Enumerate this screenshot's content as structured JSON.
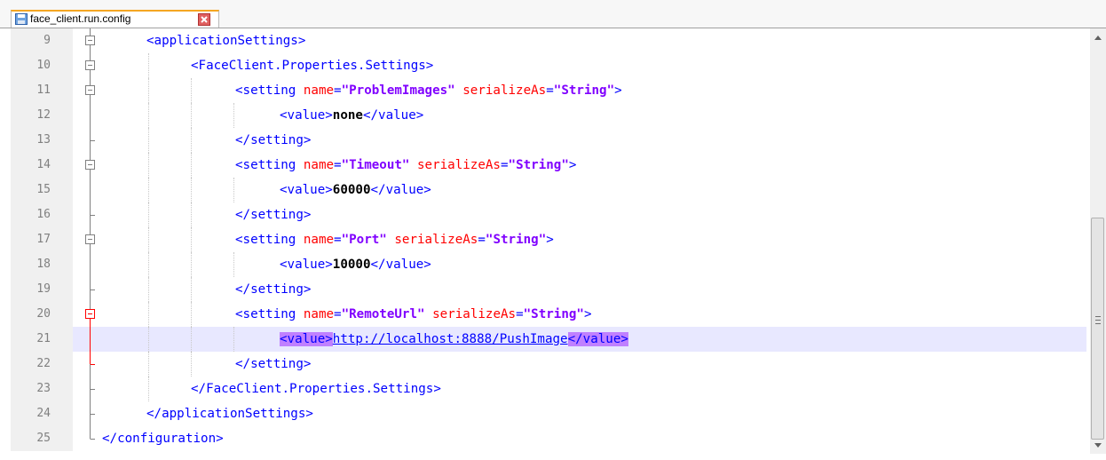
{
  "tab": {
    "title": "face_client.run.config",
    "file_icon": "save-icon",
    "close_icon": "close-icon"
  },
  "colors": {
    "tag": "#0000ff",
    "attribute": "#ff0000",
    "attribute_value": "#8000ff",
    "text": "#000000",
    "current_line": "#e8e8ff",
    "tag_match": "#c080ff",
    "fold_active": "#ff0000"
  },
  "editor": {
    "current_line": 21,
    "lines": [
      {
        "num": "9",
        "fold": "box-open",
        "indent": 1,
        "parts": [
          {
            "t": "tag",
            "v": "<applicationSettings>"
          }
        ]
      },
      {
        "num": "10",
        "fold": "box-open",
        "indent": 2,
        "parts": [
          {
            "t": "tag",
            "v": "<FaceClient.Properties.Settings>"
          }
        ]
      },
      {
        "num": "11",
        "fold": "box-open",
        "indent": 3,
        "parts": [
          {
            "t": "tag",
            "v": "<setting "
          },
          {
            "t": "attr",
            "v": "name"
          },
          {
            "t": "tag",
            "v": "="
          },
          {
            "t": "val",
            "v": "\"ProblemImages\""
          },
          {
            "t": "tag",
            "v": " "
          },
          {
            "t": "attr",
            "v": "serializeAs"
          },
          {
            "t": "tag",
            "v": "="
          },
          {
            "t": "val",
            "v": "\"String\""
          },
          {
            "t": "tag",
            "v": ">"
          }
        ]
      },
      {
        "num": "12",
        "fold": "line",
        "indent": 4,
        "parts": [
          {
            "t": "tag",
            "v": "<value>"
          },
          {
            "t": "txt",
            "v": "none"
          },
          {
            "t": "tag",
            "v": "</value>"
          }
        ]
      },
      {
        "num": "13",
        "fold": "end",
        "indent": 3,
        "parts": [
          {
            "t": "tag",
            "v": "</setting>"
          }
        ]
      },
      {
        "num": "14",
        "fold": "box-open",
        "indent": 3,
        "parts": [
          {
            "t": "tag",
            "v": "<setting "
          },
          {
            "t": "attr",
            "v": "name"
          },
          {
            "t": "tag",
            "v": "="
          },
          {
            "t": "val",
            "v": "\"Timeout\""
          },
          {
            "t": "tag",
            "v": " "
          },
          {
            "t": "attr",
            "v": "serializeAs"
          },
          {
            "t": "tag",
            "v": "="
          },
          {
            "t": "val",
            "v": "\"String\""
          },
          {
            "t": "tag",
            "v": ">"
          }
        ]
      },
      {
        "num": "15",
        "fold": "line",
        "indent": 4,
        "parts": [
          {
            "t": "tag",
            "v": "<value>"
          },
          {
            "t": "txt",
            "v": "60000"
          },
          {
            "t": "tag",
            "v": "</value>"
          }
        ]
      },
      {
        "num": "16",
        "fold": "end",
        "indent": 3,
        "parts": [
          {
            "t": "tag",
            "v": "</setting>"
          }
        ]
      },
      {
        "num": "17",
        "fold": "box-open",
        "indent": 3,
        "parts": [
          {
            "t": "tag",
            "v": "<setting "
          },
          {
            "t": "attr",
            "v": "name"
          },
          {
            "t": "tag",
            "v": "="
          },
          {
            "t": "val",
            "v": "\"Port\""
          },
          {
            "t": "tag",
            "v": " "
          },
          {
            "t": "attr",
            "v": "serializeAs"
          },
          {
            "t": "tag",
            "v": "="
          },
          {
            "t": "val",
            "v": "\"String\""
          },
          {
            "t": "tag",
            "v": ">"
          }
        ]
      },
      {
        "num": "18",
        "fold": "line",
        "indent": 4,
        "parts": [
          {
            "t": "tag",
            "v": "<value>"
          },
          {
            "t": "txt",
            "v": "10000"
          },
          {
            "t": "tag",
            "v": "</value>"
          }
        ]
      },
      {
        "num": "19",
        "fold": "end",
        "indent": 3,
        "parts": [
          {
            "t": "tag",
            "v": "</setting>"
          }
        ]
      },
      {
        "num": "20",
        "fold": "box-open-active",
        "indent": 3,
        "parts": [
          {
            "t": "tag",
            "v": "<setting "
          },
          {
            "t": "attr",
            "v": "name"
          },
          {
            "t": "tag",
            "v": "="
          },
          {
            "t": "val",
            "v": "\"RemoteUrl\""
          },
          {
            "t": "tag",
            "v": " "
          },
          {
            "t": "attr",
            "v": "serializeAs"
          },
          {
            "t": "tag",
            "v": "="
          },
          {
            "t": "val",
            "v": "\"String\""
          },
          {
            "t": "tag",
            "v": ">"
          }
        ]
      },
      {
        "num": "21",
        "fold": "line-active",
        "indent": 4,
        "parts": [
          {
            "t": "hl",
            "v": "<value>"
          },
          {
            "t": "url",
            "v": "http://localhost:8888/PushImage"
          },
          {
            "t": "hl",
            "v": "</value>"
          }
        ]
      },
      {
        "num": "22",
        "fold": "end-active",
        "indent": 3,
        "parts": [
          {
            "t": "tag",
            "v": "</setting>"
          }
        ]
      },
      {
        "num": "23",
        "fold": "end",
        "indent": 2,
        "parts": [
          {
            "t": "tag",
            "v": "</FaceClient.Properties.Settings>"
          }
        ]
      },
      {
        "num": "24",
        "fold": "end",
        "indent": 1,
        "parts": [
          {
            "t": "tag",
            "v": "</applicationSettings>"
          }
        ]
      },
      {
        "num": "25",
        "fold": "end-final",
        "indent": 0,
        "parts": [
          {
            "t": "tag",
            "v": "</configuration>"
          }
        ]
      }
    ]
  },
  "scrollbar": {
    "up_icon": "arrow-up-icon",
    "down_icon": "arrow-down-icon"
  }
}
